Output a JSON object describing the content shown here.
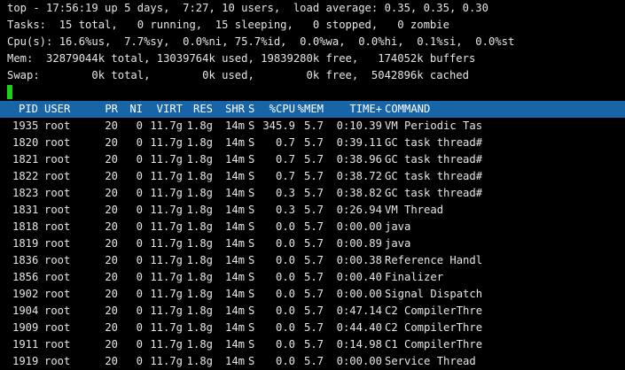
{
  "summary": {
    "line1": "top - 17:56:19 up 5 days,  7:27, 10 users,  load average: 0.35, 0.35, 0.30",
    "line2": "Tasks:  15 total,   0 running,  15 sleeping,   0 stopped,   0 zombie",
    "line3": "Cpu(s): 16.6%us,  7.7%sy,  0.0%ni, 75.7%id,  0.0%wa,  0.0%hi,  0.1%si,  0.0%st",
    "line4": "Mem:  32879044k total, 13039764k used, 19839280k free,   174052k buffers",
    "line5": "Swap:        0k total,        0k used,        0k free,  5042896k cached"
  },
  "colors": {
    "background": "#000000",
    "text": "#e6e6e6",
    "header_bar": "#1764a7",
    "cursor": "#19d119"
  },
  "table": {
    "columns": [
      "PID",
      "USER",
      "PR",
      "NI",
      "VIRT",
      "RES",
      "SHR",
      "S",
      "%CPU",
      "%MEM",
      "TIME+",
      "COMMAND"
    ],
    "rows": [
      [
        "1935",
        "root",
        "20",
        "0",
        "11.7g",
        "1.8g",
        "14m",
        "S",
        "345.9",
        "5.7",
        "0:10.39",
        "VM Periodic Tas"
      ],
      [
        "1820",
        "root",
        "20",
        "0",
        "11.7g",
        "1.8g",
        "14m",
        "S",
        "0.7",
        "5.7",
        "0:39.11",
        "GC task thread#"
      ],
      [
        "1821",
        "root",
        "20",
        "0",
        "11.7g",
        "1.8g",
        "14m",
        "S",
        "0.7",
        "5.7",
        "0:38.96",
        "GC task thread#"
      ],
      [
        "1822",
        "root",
        "20",
        "0",
        "11.7g",
        "1.8g",
        "14m",
        "S",
        "0.7",
        "5.7",
        "0:38.72",
        "GC task thread#"
      ],
      [
        "1823",
        "root",
        "20",
        "0",
        "11.7g",
        "1.8g",
        "14m",
        "S",
        "0.3",
        "5.7",
        "0:38.82",
        "GC task thread#"
      ],
      [
        "1831",
        "root",
        "20",
        "0",
        "11.7g",
        "1.8g",
        "14m",
        "S",
        "0.3",
        "5.7",
        "0:26.94",
        "VM Thread"
      ],
      [
        "1818",
        "root",
        "20",
        "0",
        "11.7g",
        "1.8g",
        "14m",
        "S",
        "0.0",
        "5.7",
        "0:00.00",
        "java"
      ],
      [
        "1819",
        "root",
        "20",
        "0",
        "11.7g",
        "1.8g",
        "14m",
        "S",
        "0.0",
        "5.7",
        "0:00.89",
        "java"
      ],
      [
        "1836",
        "root",
        "20",
        "0",
        "11.7g",
        "1.8g",
        "14m",
        "S",
        "0.0",
        "5.7",
        "0:00.38",
        "Reference Handl"
      ],
      [
        "1856",
        "root",
        "20",
        "0",
        "11.7g",
        "1.8g",
        "14m",
        "S",
        "0.0",
        "5.7",
        "0:00.40",
        "Finalizer"
      ],
      [
        "1902",
        "root",
        "20",
        "0",
        "11.7g",
        "1.8g",
        "14m",
        "S",
        "0.0",
        "5.7",
        "0:00.00",
        "Signal Dispatch"
      ],
      [
        "1904",
        "root",
        "20",
        "0",
        "11.7g",
        "1.8g",
        "14m",
        "S",
        "0.0",
        "5.7",
        "0:47.14",
        "C2 CompilerThre"
      ],
      [
        "1909",
        "root",
        "20",
        "0",
        "11.7g",
        "1.8g",
        "14m",
        "S",
        "0.0",
        "5.7",
        "0:44.40",
        "C2 CompilerThre"
      ],
      [
        "1911",
        "root",
        "20",
        "0",
        "11.7g",
        "1.8g",
        "14m",
        "S",
        "0.0",
        "5.7",
        "0:14.98",
        "C1 CompilerThre"
      ],
      [
        "1919",
        "root",
        "20",
        "0",
        "11.7g",
        "1.8g",
        "14m",
        "S",
        "0.0",
        "5.7",
        "0:00.00",
        "Service Thread"
      ]
    ]
  }
}
